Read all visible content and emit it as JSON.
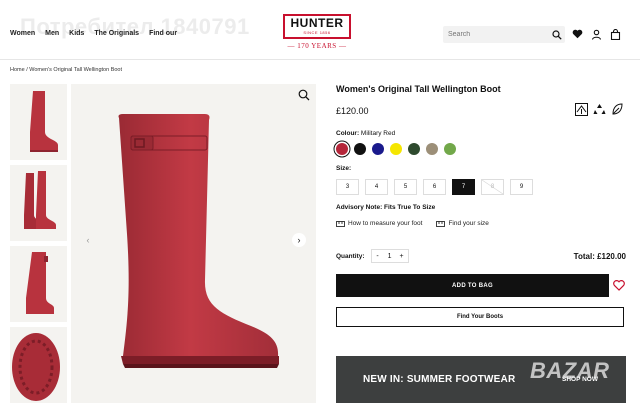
{
  "watermark": "Потребител 1840791",
  "nav": [
    "Women",
    "Men",
    "Kids",
    "The Originals",
    "Find our"
  ],
  "logo": {
    "text": "HUNTER",
    "sub": "SINCE 1856",
    "years": "— 170 YEARS —"
  },
  "search": {
    "placeholder": "Search"
  },
  "header_icons": [
    "heart-icon",
    "user-icon",
    "bag-icon"
  ],
  "breadcrumb": "Home /  Women's Original Tall Wellington Boot",
  "product": {
    "title": "Women's Original Tall Wellington Boot",
    "price": "£120.00",
    "badges": [
      "vegan-icon",
      "recycle-icon",
      "leaf-icon"
    ],
    "colour_label": "Colour:",
    "colour_value": "Military Red",
    "swatches": [
      "#b5263a",
      "#111111",
      "#1a1a8c",
      "#f5e600",
      "#2e4a2e",
      "#9c8f78",
      "#72a84a"
    ],
    "selected_swatch": 0,
    "size_label": "Size:",
    "sizes": [
      "3",
      "4",
      "5",
      "6",
      "7",
      "8",
      "9"
    ],
    "selected_size": "7",
    "unavailable_size": "8",
    "advisory": "Advisory Note: Fits True To Size",
    "measure_link": "How to measure your foot",
    "find_size_link": "Find your size",
    "quantity_label": "Quantity:",
    "quantity_minus": "-",
    "quantity_value": "1",
    "quantity_plus": "+",
    "total": "Total: £120.00",
    "add_to_bag": "ADD TO BAG",
    "find_boots": "Find Your Boots"
  },
  "promo": {
    "title": "NEW IN: SUMMER FOOTWEAR",
    "cta": "SHOP NOW"
  },
  "site_watermark": "BAZAR",
  "colors": {
    "boot": "#b8333e",
    "accent": "#c8102e",
    "image_bg": "#f4f3f0"
  }
}
